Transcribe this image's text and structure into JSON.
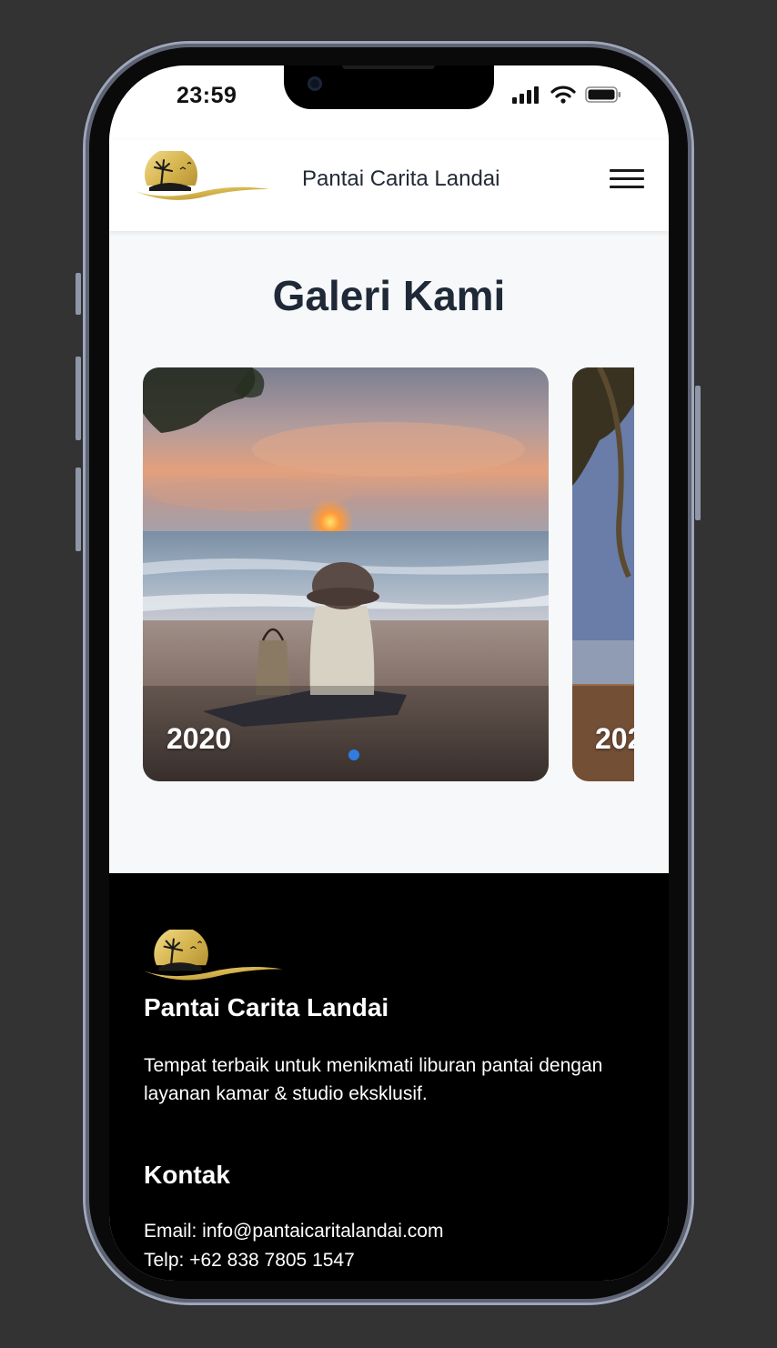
{
  "status_bar": {
    "time": "23:59"
  },
  "navbar": {
    "brand": "Pantai Carita Landai"
  },
  "gallery": {
    "title": "Galeri Kami",
    "cards": [
      {
        "year": "2020"
      },
      {
        "year": "202"
      }
    ],
    "active_index": 0
  },
  "footer": {
    "title": "Pantai Carita Landai",
    "description": "Tempat terbaik untuk menikmati liburan pantai dengan layanan kamar & studio eksklusif.",
    "contact_heading": "Kontak",
    "email": "Email: info@pantaicaritalandai.com",
    "telp": "Telp: +62 838 7805 1547"
  },
  "colors": {
    "background": "#333333",
    "screen": "#f7f8fa",
    "title": "#1f2937",
    "footer": "#000000",
    "dot_active": "#2f7de1",
    "logo_gold": "#d4b24c"
  },
  "icons": [
    "signal-icon",
    "wifi-icon",
    "battery-icon",
    "hamburger-menu-icon",
    "beach-logo-icon"
  ]
}
